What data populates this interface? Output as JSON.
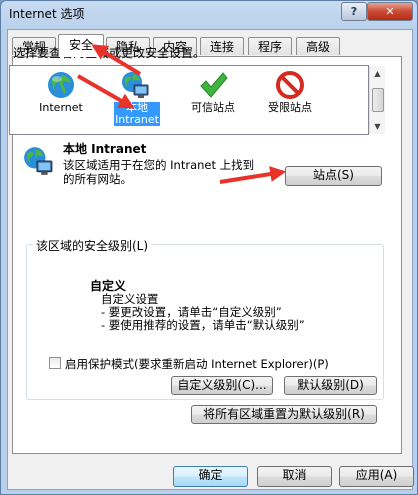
{
  "window": {
    "title": "Internet 选项",
    "help": "?",
    "close": "✕"
  },
  "tabs": [
    {
      "label": "常规"
    },
    {
      "label": "安全",
      "active": true
    },
    {
      "label": "隐私"
    },
    {
      "label": "内容"
    },
    {
      "label": "连接"
    },
    {
      "label": "程序"
    },
    {
      "label": "高级"
    }
  ],
  "security": {
    "instruction": "选择要查看的区域或更改安全设置。",
    "zones": [
      {
        "label": "Internet",
        "icon": "globe-icon"
      },
      {
        "label": "本地\nIntranet",
        "icon": "local-intranet-icon",
        "selected": true
      },
      {
        "label": "可信站点",
        "icon": "checkmark-icon"
      },
      {
        "label": "受限站点",
        "icon": "restricted-icon"
      }
    ],
    "current_zone": {
      "name": "本地 Intranet",
      "description": "该区域适用于在您的 Intranet 上找到的所有网站。"
    },
    "sites_button": "站点(S)",
    "level_group_label": "该区域的安全级别(L)",
    "custom": {
      "title": "自定义",
      "lines": [
        "自定义设置",
        "- 要更改设置，请单击“自定义级别”",
        "- 要使用推荐的设置，请单击“默认级别”"
      ]
    },
    "protected_mode": "启用保护模式(要求重新启动 Internet Explorer)(P)",
    "protected_mode_checked": false,
    "custom_level_button": "自定义级别(C)...",
    "default_level_button": "默认级别(D)",
    "reset_all_button": "将所有区域重置为默认级别(R)"
  },
  "footer": {
    "ok": "确定",
    "cancel": "取消",
    "apply": "应用(A)"
  },
  "colors": {
    "arrow": "#e8322a",
    "selection": "#3399ff"
  }
}
